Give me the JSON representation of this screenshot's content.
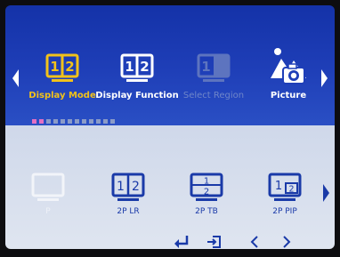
{
  "menu": {
    "items": [
      {
        "id": "display-mode",
        "label": "Display Mode",
        "state": "selected",
        "icon": "split-screen-12-icon",
        "icon_text": [
          "1",
          "2"
        ]
      },
      {
        "id": "display-function",
        "label": "Display Function",
        "state": "normal",
        "icon": "split-screen-12-icon",
        "icon_text": [
          "1",
          "2"
        ]
      },
      {
        "id": "select-region",
        "label": "Select Region",
        "state": "disabled",
        "icon": "select-region-icon",
        "icon_text": [
          "1"
        ]
      },
      {
        "id": "picture",
        "label": "Picture",
        "state": "normal",
        "icon": "picture-camera-icon"
      }
    ],
    "page_dots": {
      "count": 12,
      "active": [
        0,
        1
      ]
    }
  },
  "submenu": {
    "items": [
      {
        "id": "p",
        "label": "P",
        "state": "disabled",
        "icon": "single-screen-icon"
      },
      {
        "id": "2p-lr",
        "label": "2P LR",
        "state": "normal",
        "icon": "split-left-right-icon",
        "icon_text": [
          "1",
          "2"
        ]
      },
      {
        "id": "2p-tb",
        "label": "2P TB",
        "state": "normal",
        "icon": "split-top-bottom-icon",
        "icon_text": [
          "1",
          "2"
        ]
      },
      {
        "id": "2p-pip",
        "label": "2P PIP",
        "state": "normal",
        "icon": "picture-in-picture-icon",
        "icon_text": [
          "1",
          "2"
        ]
      }
    ]
  },
  "nav": [
    {
      "id": "enter",
      "icon": "enter-icon"
    },
    {
      "id": "exit",
      "icon": "exit-icon"
    },
    {
      "id": "prev",
      "icon": "chevron-left-icon"
    },
    {
      "id": "next",
      "icon": "chevron-right-icon"
    }
  ],
  "colors": {
    "top_bg": "#1f3fb8",
    "bottom_bg": "#dfe5f0",
    "selected": "#f2c21a",
    "icon_blue": "#1a3aa8",
    "dot_active": "#e36fc2",
    "dot_inactive": "#8a9bc8"
  }
}
